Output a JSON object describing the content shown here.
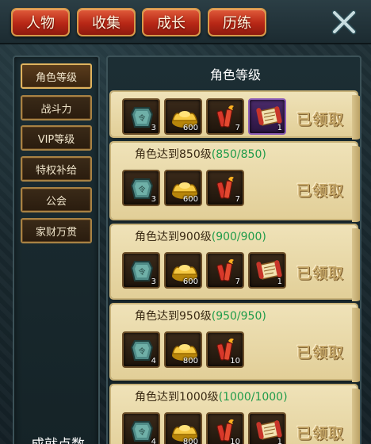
{
  "top_tabs": [
    "人物",
    "收集",
    "成长",
    "历练"
  ],
  "side_menu": [
    "角色等级",
    "战斗力",
    "VIP等级",
    "特权补给",
    "公会",
    "家财万贯"
  ],
  "achievement_points_label": "成就点数",
  "panel_title": "角色等级",
  "claimed_label": "已领取",
  "icons": [
    "close-icon",
    "jade-token-icon",
    "gold-ingot-icon",
    "firecracker-icon",
    "scroll-icon"
  ],
  "rows": [
    {
      "title": "",
      "progress": "",
      "items": [
        {
          "icon": "jade-token-icon",
          "count": "3"
        },
        {
          "icon": "gold-ingot-icon",
          "count": "600"
        },
        {
          "icon": "firecracker-icon",
          "count": "7"
        },
        {
          "icon": "scroll-icon",
          "count": "1"
        }
      ]
    },
    {
      "title": "角色达到850级",
      "progress": "(850/850)",
      "items": [
        {
          "icon": "jade-token-icon",
          "count": "3"
        },
        {
          "icon": "gold-ingot-icon",
          "count": "600"
        },
        {
          "icon": "firecracker-icon",
          "count": "7"
        }
      ]
    },
    {
      "title": "角色达到900级",
      "progress": "(900/900)",
      "items": [
        {
          "icon": "jade-token-icon",
          "count": "3"
        },
        {
          "icon": "gold-ingot-icon",
          "count": "600"
        },
        {
          "icon": "firecracker-icon",
          "count": "7"
        },
        {
          "icon": "scroll-icon",
          "count": "1"
        }
      ]
    },
    {
      "title": "角色达到950级",
      "progress": "(950/950)",
      "items": [
        {
          "icon": "jade-token-icon",
          "count": "4"
        },
        {
          "icon": "gold-ingot-icon",
          "count": "800"
        },
        {
          "icon": "firecracker-icon",
          "count": "10"
        }
      ]
    },
    {
      "title": "角色达到1000级",
      "progress": "(1000/1000)",
      "items": [
        {
          "icon": "jade-token-icon",
          "count": "4"
        },
        {
          "icon": "gold-ingot-icon",
          "count": "800"
        },
        {
          "icon": "firecracker-icon",
          "count": "10"
        },
        {
          "icon": "scroll-icon",
          "count": "1"
        }
      ]
    }
  ]
}
